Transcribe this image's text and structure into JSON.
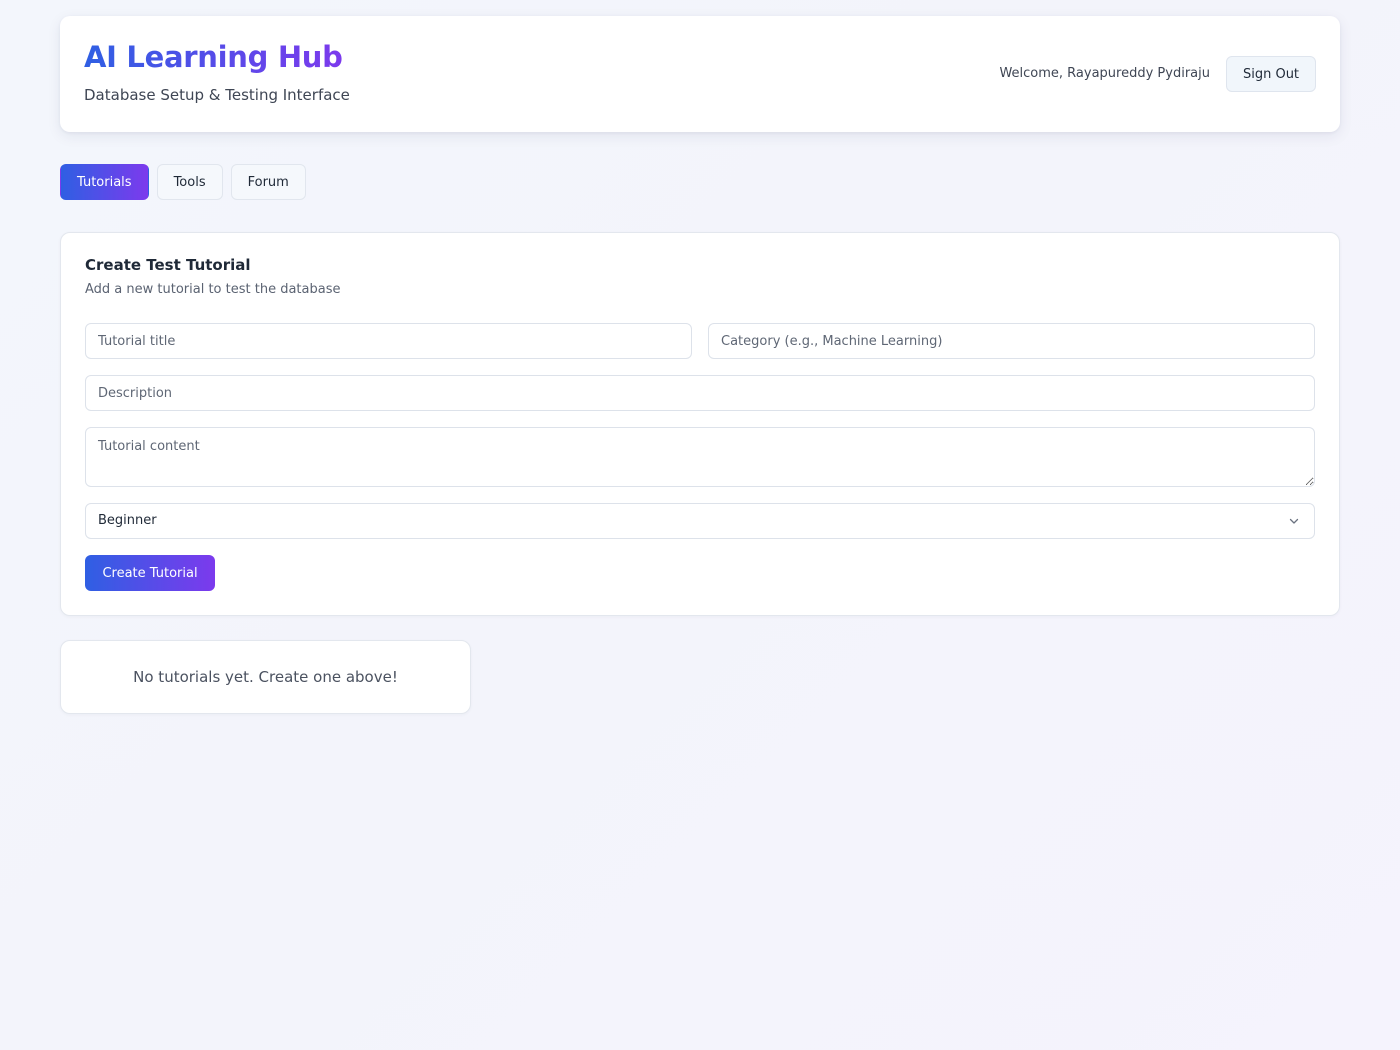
{
  "header": {
    "title": "AI Learning Hub",
    "subtitle": "Database Setup & Testing Interface",
    "welcome": "Welcome, Rayapureddy Pydiraju",
    "sign_out_label": "Sign Out"
  },
  "tabs": [
    {
      "label": "Tutorials",
      "active": true
    },
    {
      "label": "Tools",
      "active": false
    },
    {
      "label": "Forum",
      "active": false
    }
  ],
  "form": {
    "title": "Create Test Tutorial",
    "subtitle": "Add a new tutorial to test the database",
    "title_placeholder": "Tutorial title",
    "category_placeholder": "Category (e.g., Machine Learning)",
    "description_placeholder": "Description",
    "content_placeholder": "Tutorial content",
    "level_selected": "Beginner",
    "submit_label": "Create Tutorial"
  },
  "empty_state": {
    "message": "No tutorials yet. Create one above!"
  },
  "colors": {
    "accent_start": "#2f5fe3",
    "accent_end": "#7c3aed"
  }
}
